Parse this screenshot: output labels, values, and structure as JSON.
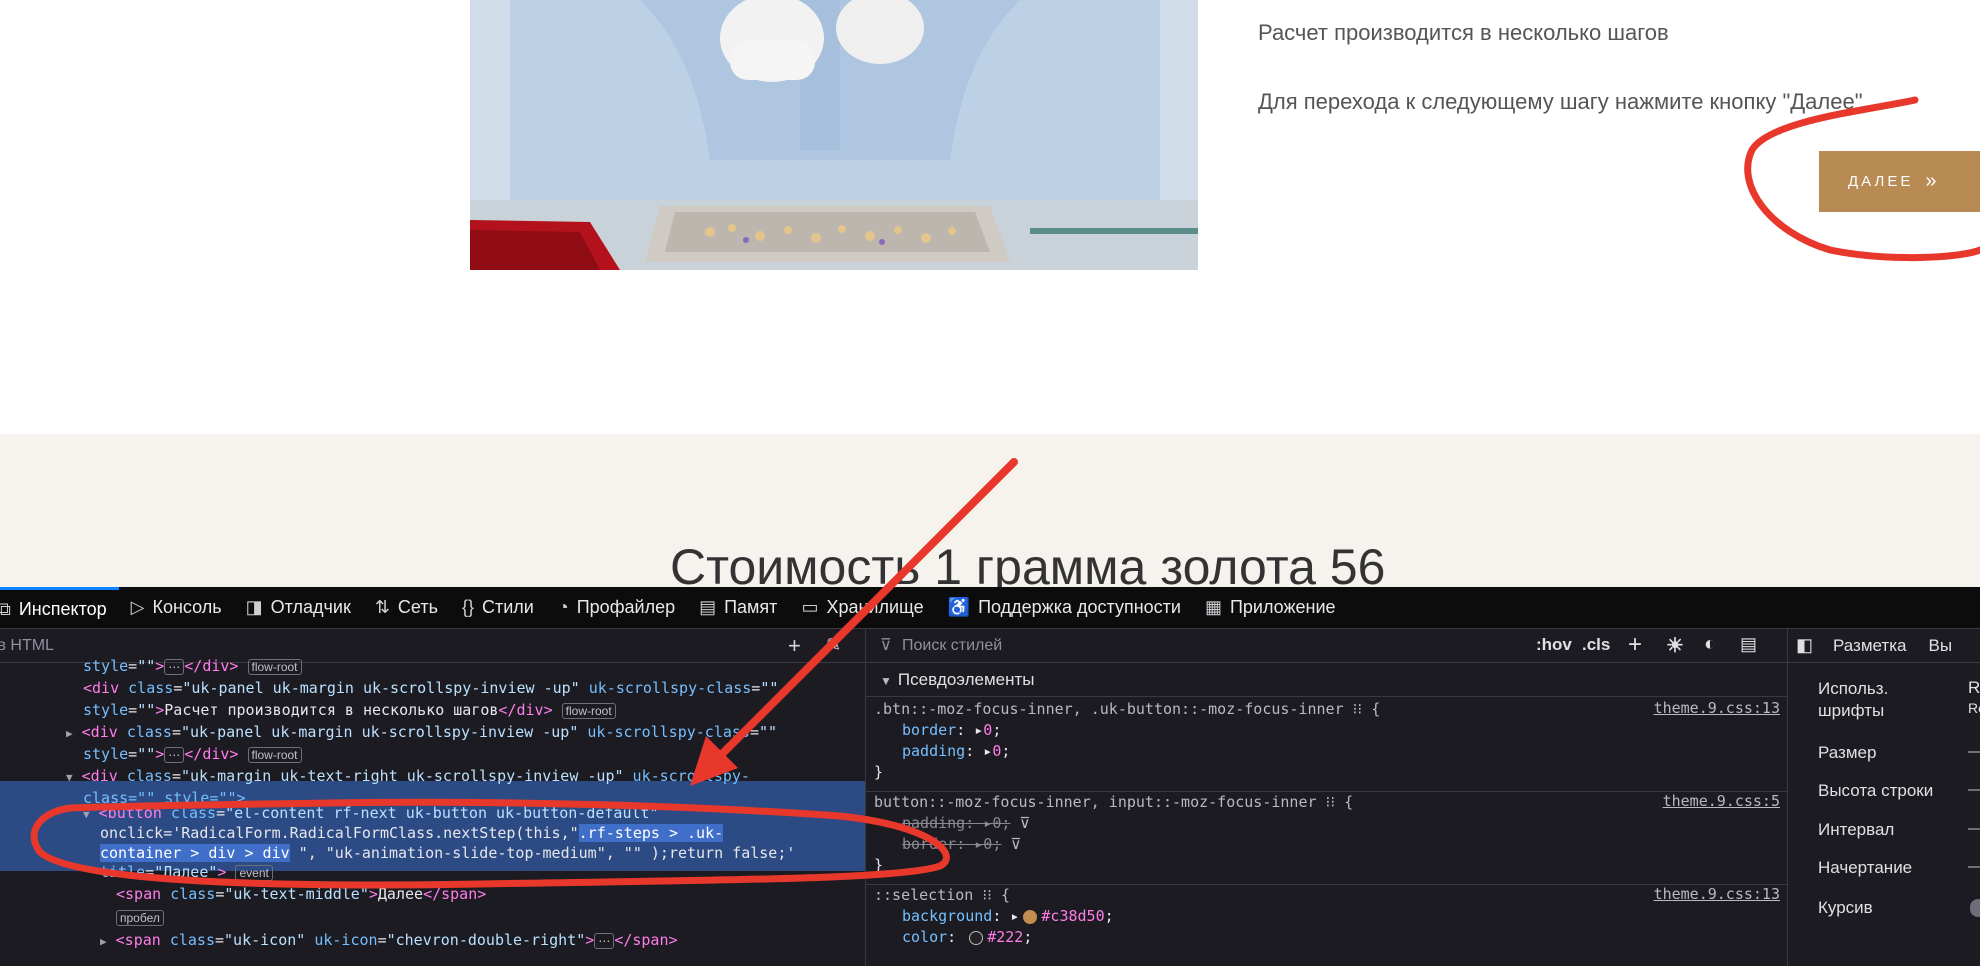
{
  "site": {
    "intro_line1": "Расчет производится в несколько шагов",
    "intro_line2": "Для перехода к следующему шагу нажмите кнопку \"Далее\"",
    "next_button": "ДАЛЕЕ",
    "next_icon": "»",
    "section_title": "Стоимость 1 грамма золота 56"
  },
  "devtools": {
    "tabs": [
      {
        "icon": "⧉",
        "label": "Инспектор"
      },
      {
        "icon": "▷",
        "label": "Консоль"
      },
      {
        "icon": "◨",
        "label": "Отладчик"
      },
      {
        "icon": "⇅",
        "label": "Сеть"
      },
      {
        "icon": "{}",
        "label": "Стили"
      },
      {
        "icon": "◔",
        "label": "Профайлер"
      },
      {
        "icon": "▤",
        "label": "Памят"
      },
      {
        "icon": "▭",
        "label": "Хранилище"
      },
      {
        "icon": "♿",
        "label": "Поддержка доступности"
      },
      {
        "icon": "▦",
        "label": "Приложение"
      }
    ],
    "html_search_placeholder": "к в HTML",
    "html": {
      "l0_attr": "style",
      "l0_val": "\"\"",
      "l0_ellipsis": "⋯",
      "l0_close": "</div>",
      "badge_flow_root": "flow-root",
      "l1_tag": "<div",
      "l1_class": "class",
      "l1_class_val": "\"uk-panel uk-margin uk-scrollspy-inview -up\"",
      "l1_spy": "uk-scrollspy-class",
      "l1_spy_val": "\"\"",
      "l2_style": "style",
      "l2_style_val": "\"\"",
      "l2_text": "Расчет производится в несколько шагов",
      "l2_close": "</div>",
      "l3_class_val": "\"uk-panel uk-margin uk-scrollspy-inview -up\"",
      "l3_spy": "uk-scrollspy-class",
      "l4_ellipsis": "⋯",
      "l5_class_val": "\"uk-margin uk-text-right uk-scrollspy-inview -up\"",
      "l5_spy": "uk-scrollspy-",
      "l6_text": "class=\"\" style=\"\">",
      "l7_tag": "<button",
      "l7_class_val": "\"el-content rf-next uk-button uk-button-default\"",
      "l8_a": "onclick='RadicalForm.RadicalFormClass.nextStep(this,\"",
      "l8_b": ".rf-steps > .uk-",
      "l9_a": "container > div > div",
      "l9_b": " \", \"uk-animation-slide-top-medium\", \"\" );return false;'",
      "l10_title": "title",
      "l10_title_val": "\"Далее\"",
      "badge_event": "event",
      "l11_tag": "<span",
      "l11_class_val": "\"uk-text-middle\"",
      "l11_text": "Далее",
      "l11_close": "</span>",
      "badge_space": "пробел",
      "l13_class_val": "\"uk-icon\"",
      "l13_icon_attr": "uk-icon",
      "l13_icon_val": "\"chevron-double-right\"",
      "l13_ellipsis": "⋯",
      "l13_close": "</span>"
    },
    "styles": {
      "filter_placeholder": "Поиск стилей",
      "hov": ":hov",
      "cls": ".cls",
      "pseudo": "Псевдоэлементы",
      "rules": [
        {
          "selector": ".btn::-moz-focus-inner, .uk-button::-moz-focus-inner",
          "source": "theme.9.css:13",
          "decls": [
            {
              "prop": "border",
              "value": "0"
            },
            {
              "prop": "padding",
              "value": "0"
            }
          ]
        },
        {
          "selector": "button::-moz-focus-inner, input::-moz-focus-inner",
          "source": "theme.9.css:5",
          "decls": [
            {
              "prop": "padding",
              "value": "0"
            },
            {
              "prop": "border",
              "value": "0"
            }
          ]
        },
        {
          "selector": "::selection",
          "source": "theme.9.css:13",
          "decls": [
            {
              "prop": "background",
              "value": "#c38d50"
            },
            {
              "prop": "color",
              "value": "#222"
            }
          ]
        }
      ]
    },
    "layout": {
      "tab": "Разметка",
      "tab_next": "Вы",
      "used_fonts": "Использ.\nшрифты",
      "used_fonts_value": "R",
      "used_fonts_value2": "Ro",
      "props": [
        "Размер",
        "Высота строки",
        "Интервал",
        "Начертание",
        "Курсив"
      ]
    }
  },
  "colors": {
    "accent_button": "#b88b55",
    "selection_swatch": "#c38d50",
    "annotation_red": "#e8382c"
  }
}
